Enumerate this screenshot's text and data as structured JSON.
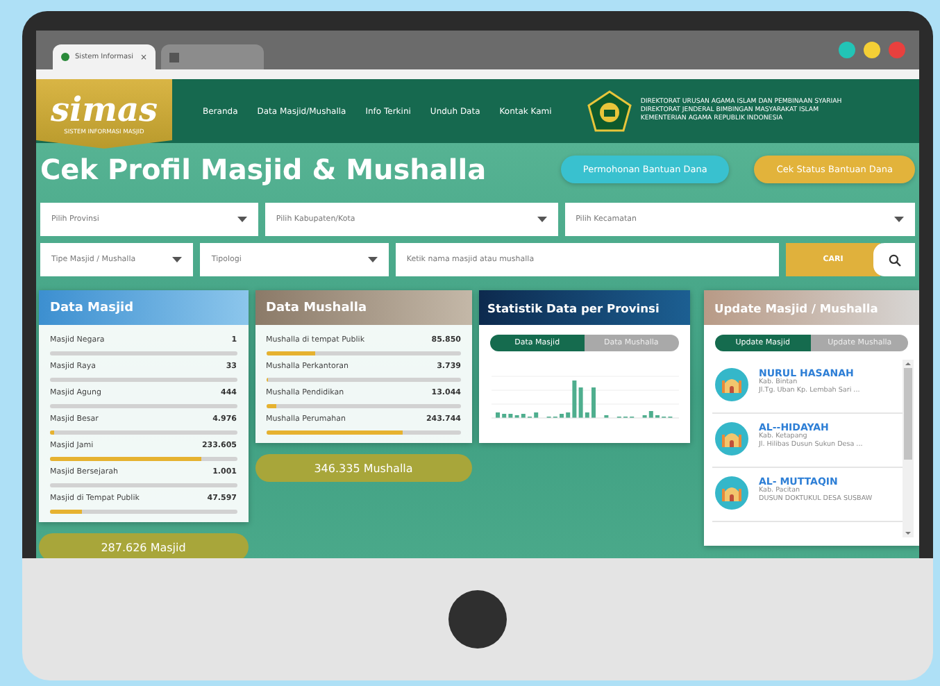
{
  "browser": {
    "tabs": [
      {
        "label": "Sistem Informasi",
        "close": "×",
        "selected": true
      },
      {
        "selected": false
      }
    ],
    "window_controls": [
      {
        "color": "#22c4b6"
      },
      {
        "color": "#f4cf36"
      },
      {
        "color": "#e8403e"
      }
    ]
  },
  "nav": {
    "logo": {
      "wordmark": "simas",
      "subtitle": "SISTEM INFORMASI MASJID"
    },
    "menu": [
      "Beranda",
      "Data Masjid/Mushalla",
      "Info Terkini",
      "Unduh Data",
      "Kontak Kami"
    ],
    "agency_lines": [
      "DIREKTORAT URUSAN AGAMA ISLAM DAN PEMBINAAN SYARIAH",
      "DIREKTORAT JENDERAL BIMBINGAN MASYARAKAT ISLAM",
      "KEMENTERIAN AGAMA REPUBLIK INDONESIA"
    ]
  },
  "hero": {
    "title": "Cek Profil Masjid & Mushalla",
    "buttons": [
      {
        "label": "Permohonan Bantuan Dana",
        "kind": "info"
      },
      {
        "label": "Cek Status Bantuan Dana",
        "kind": "warning"
      }
    ]
  },
  "filters": {
    "row_1": [
      {
        "kind": "select",
        "placeholder": "Pilih Provinsi"
      },
      {
        "kind": "select",
        "placeholder": "Pilih Kabupaten/Kota"
      },
      {
        "kind": "select",
        "placeholder": "Pilih Kecamatan"
      }
    ],
    "row_2": [
      {
        "kind": "select",
        "placeholder": "Tipe Masjid / Mushalla"
      },
      {
        "kind": "select",
        "placeholder": "Tipologi"
      },
      {
        "kind": "text",
        "placeholder": "Ketik nama masjid atau mushalla"
      }
    ],
    "search_button": "CARI"
  },
  "data_masjid": {
    "title": "Data Masjid",
    "rows": [
      {
        "name": "Masjid Negara",
        "count": "1",
        "level": 0.0
      },
      {
        "name": "Masjid Raya",
        "count": "33",
        "level": 0.0
      },
      {
        "name": "Masjid Agung",
        "count": "444",
        "level": 0.0
      },
      {
        "name": "Masjid Besar",
        "count": "4.976",
        "level": 0.02
      },
      {
        "name": "Masjid Jami",
        "count": "233.605",
        "level": 0.81
      },
      {
        "name": "Masjid Bersejarah",
        "count": "1.001",
        "level": 0.0
      },
      {
        "name": "Masjid di Tempat Publik",
        "count": "47.597",
        "level": 0.17
      }
    ],
    "total": "287.626 Masjid"
  },
  "data_mushalla": {
    "title": "Data Mushalla",
    "rows": [
      {
        "name": "Mushalla di tempat Publik",
        "count": "85.850",
        "level": 0.25
      },
      {
        "name": "Mushalla Perkantoran",
        "count": "3.739",
        "level": 0.01
      },
      {
        "name": "Mushalla Pendidikan",
        "count": "13.044",
        "level": 0.05
      },
      {
        "name": "Mushalla Perumahan",
        "count": "243.744",
        "level": 0.7
      }
    ],
    "total": "346.335 Mushalla"
  },
  "statistics": {
    "title": "Statistik Data per Provinsi",
    "tabs": [
      {
        "label": "Data Masjid",
        "selected": true
      },
      {
        "label": "Data Mushalla",
        "selected": false
      }
    ]
  },
  "updates": {
    "title": "Update Masjid / Mushalla",
    "tabs": [
      {
        "label": "Update Masjid",
        "selected": true
      },
      {
        "label": "Update Mushalla",
        "selected": false
      }
    ],
    "items": [
      {
        "name": "NURUL HASANAH",
        "region": "Kab. Bintan",
        "address": "Jl.Tg. Uban Kp. Lembah Sari ..."
      },
      {
        "name": "AL--HIDAYAH",
        "region": "Kab. Ketapang",
        "address": "Jl. Hilibas Dusun Sukun Desa ..."
      },
      {
        "name": "AL- MUTTAQIN",
        "region": "Kab. Pacitan",
        "address": "DUSUN DOKTUKUL DESA SUSBAW"
      }
    ]
  }
}
